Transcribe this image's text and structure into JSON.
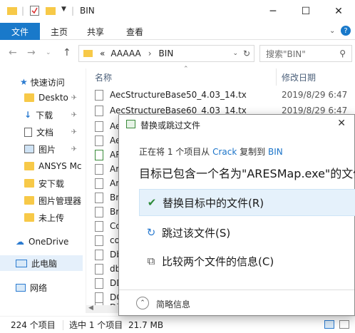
{
  "window": {
    "title": "BIN",
    "minimize": "─",
    "maximize": "☐",
    "close": "✕"
  },
  "ribbon": {
    "file_tab": "文件",
    "tabs": [
      "主页",
      "共享",
      "查看"
    ]
  },
  "address": {
    "path_prefix": "«",
    "segments": [
      "AAAAA",
      "BIN"
    ],
    "search_placeholder": "搜索\"BIN\""
  },
  "sidebar": {
    "items": [
      {
        "label": "快速访问",
        "icon": "star-icon"
      },
      {
        "label": "Deskto",
        "icon": "folder-icon",
        "pinned": true
      },
      {
        "label": "下载",
        "icon": "download-icon",
        "pinned": true
      },
      {
        "label": "文档",
        "icon": "document-icon",
        "pinned": true
      },
      {
        "label": "图片",
        "icon": "picture-icon",
        "pinned": true
      },
      {
        "label": "ANSYS Mc",
        "icon": "folder-icon"
      },
      {
        "label": "安下载",
        "icon": "folder-icon"
      },
      {
        "label": "图片管理器",
        "icon": "folder-icon"
      },
      {
        "label": "未上传",
        "icon": "folder-icon"
      },
      {
        "label": "OneDrive",
        "icon": "cloud-icon"
      },
      {
        "label": "此电脑",
        "icon": "computer-icon"
      },
      {
        "label": "网络",
        "icon": "network-icon"
      }
    ]
  },
  "filelist": {
    "col_name": "名称",
    "col_date": "修改日期",
    "rows": [
      {
        "name": "AecStructureBase50_4.03_14.tx",
        "date": "2019/8/29 6:47"
      },
      {
        "name": "AecStructureBase60_4.03_14.tx",
        "date": "2019/8/29 6:47"
      },
      {
        "name": "Ae",
        "date": ""
      },
      {
        "name": "Ae",
        "date": ""
      },
      {
        "name": "AR",
        "date": ""
      },
      {
        "name": "Ar",
        "date": ""
      },
      {
        "name": "Ar",
        "date": ""
      },
      {
        "name": "Br",
        "date": ""
      },
      {
        "name": "Br",
        "date": ""
      },
      {
        "name": "Co",
        "date": ""
      },
      {
        "name": "co",
        "date": ""
      },
      {
        "name": "Db",
        "date": ""
      },
      {
        "name": "db",
        "date": ""
      },
      {
        "name": "DD",
        "date": ""
      },
      {
        "name": "DG",
        "date": ""
      },
      {
        "name": "Di",
        "date": ""
      }
    ]
  },
  "status": {
    "count": "224 个项目",
    "selected": "选中 1 个项目",
    "size": "21.7 MB"
  },
  "dialog": {
    "title": "替换或跳过文件",
    "info_prefix": "正在将 1 个项目从",
    "info_src": "Crack",
    "info_mid": "复制到",
    "info_dst": "BIN",
    "headline": "目标已包含一个名为\"ARESMap.exe\"的文件",
    "options": [
      {
        "label": "替换目标中的文件(R)",
        "icon": "checkmark-icon"
      },
      {
        "label": "跳过该文件(S)",
        "icon": "skip-icon"
      },
      {
        "label": "比较两个文件的信息(C)",
        "icon": "compare-icon"
      }
    ],
    "footer": "简略信息",
    "close": "✕"
  },
  "colors": {
    "accent": "#1979ca",
    "folder": "#f7c948",
    "check": "#2e8b3a",
    "link": "#1a73c8"
  }
}
